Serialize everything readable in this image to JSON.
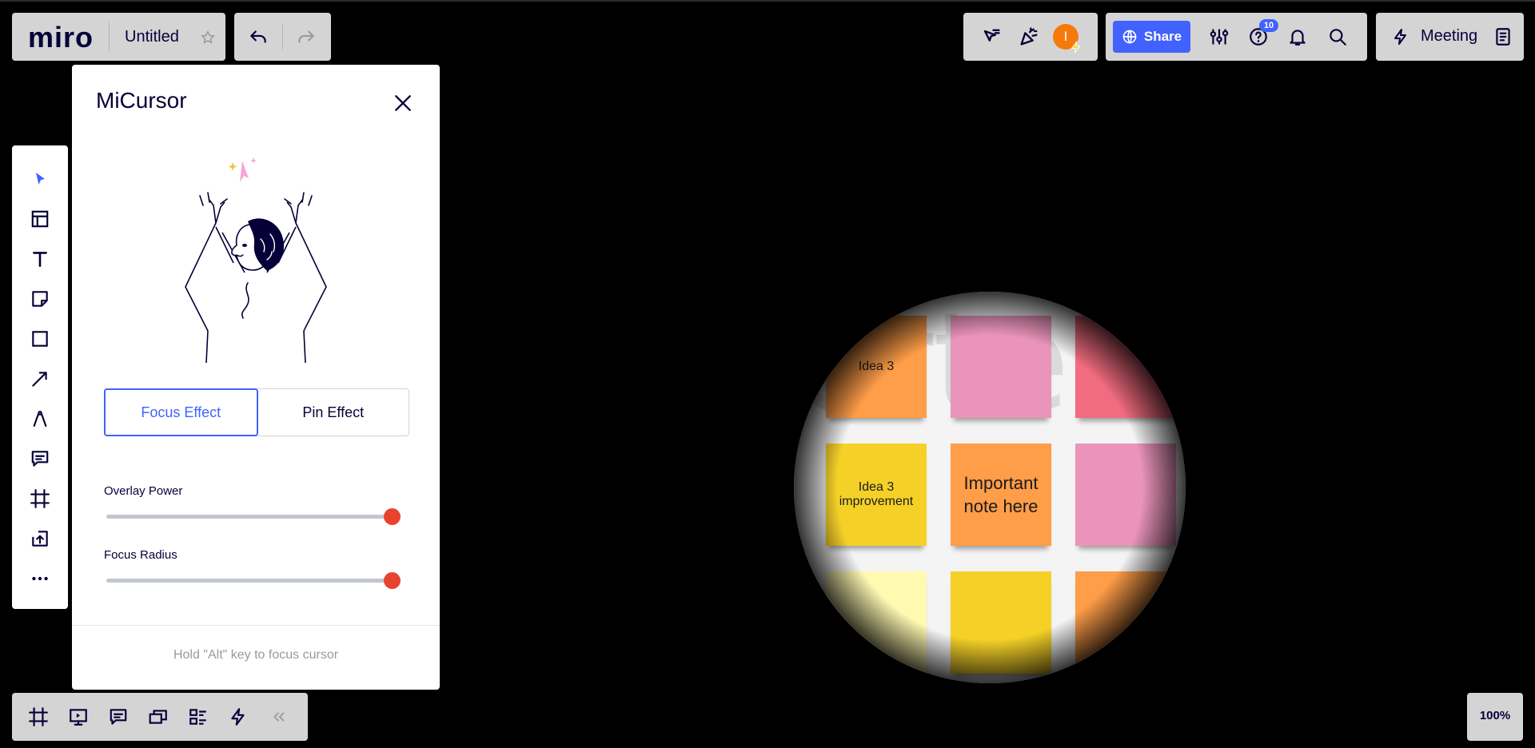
{
  "app": {
    "logo": "miro",
    "board_title": "Untitled"
  },
  "header": {
    "share_label": "Share",
    "help_badge": "10",
    "avatar_initial": "I",
    "meeting_label": "Meeting"
  },
  "plugin": {
    "title": "MiCursor",
    "modes": [
      {
        "label": "Focus Effect",
        "active": true
      },
      {
        "label": "Pin Effect",
        "active": false
      }
    ],
    "sliders": [
      {
        "label": "Overlay Power",
        "value": 1.0
      },
      {
        "label": "Focus Radius",
        "value": 1.0
      }
    ],
    "hint": "Hold \"Alt\" key to focus cursor"
  },
  "canvas": {
    "background_text": "orte",
    "stickies": [
      {
        "text": "Idea 3",
        "color": "#ff9d48"
      },
      {
        "text": "",
        "color": "#ea94bb"
      },
      {
        "text": "",
        "color": "#f16c7f"
      },
      {
        "text": "Idea 3 improvement",
        "color": "#f5d128"
      },
      {
        "text": "Important note here",
        "color": "#ff9d48"
      },
      {
        "text": "",
        "color": "#ea94bb"
      },
      {
        "text": "",
        "color": "#fff9b1"
      },
      {
        "text": "",
        "color": "#f5d128"
      },
      {
        "text": "",
        "color": "#ff9d48"
      }
    ]
  },
  "zoom": {
    "label": "100%"
  },
  "colors": {
    "accent": "#4262ff",
    "slider_thumb": "#e8432f",
    "ink": "#050038"
  },
  "toolbar": {
    "tools": [
      "select-icon",
      "templates-icon",
      "text-icon",
      "sticky-note-icon",
      "shape-icon",
      "connection-line-icon",
      "pen-icon",
      "comment-icon",
      "frame-icon",
      "upload-icon",
      "more-icon"
    ]
  },
  "bottom_bar": {
    "tools": [
      "frames-icon",
      "presentation-icon",
      "comments-icon",
      "video-chat-icon",
      "card-list-icon",
      "activity-icon",
      "collapse-icon"
    ]
  }
}
